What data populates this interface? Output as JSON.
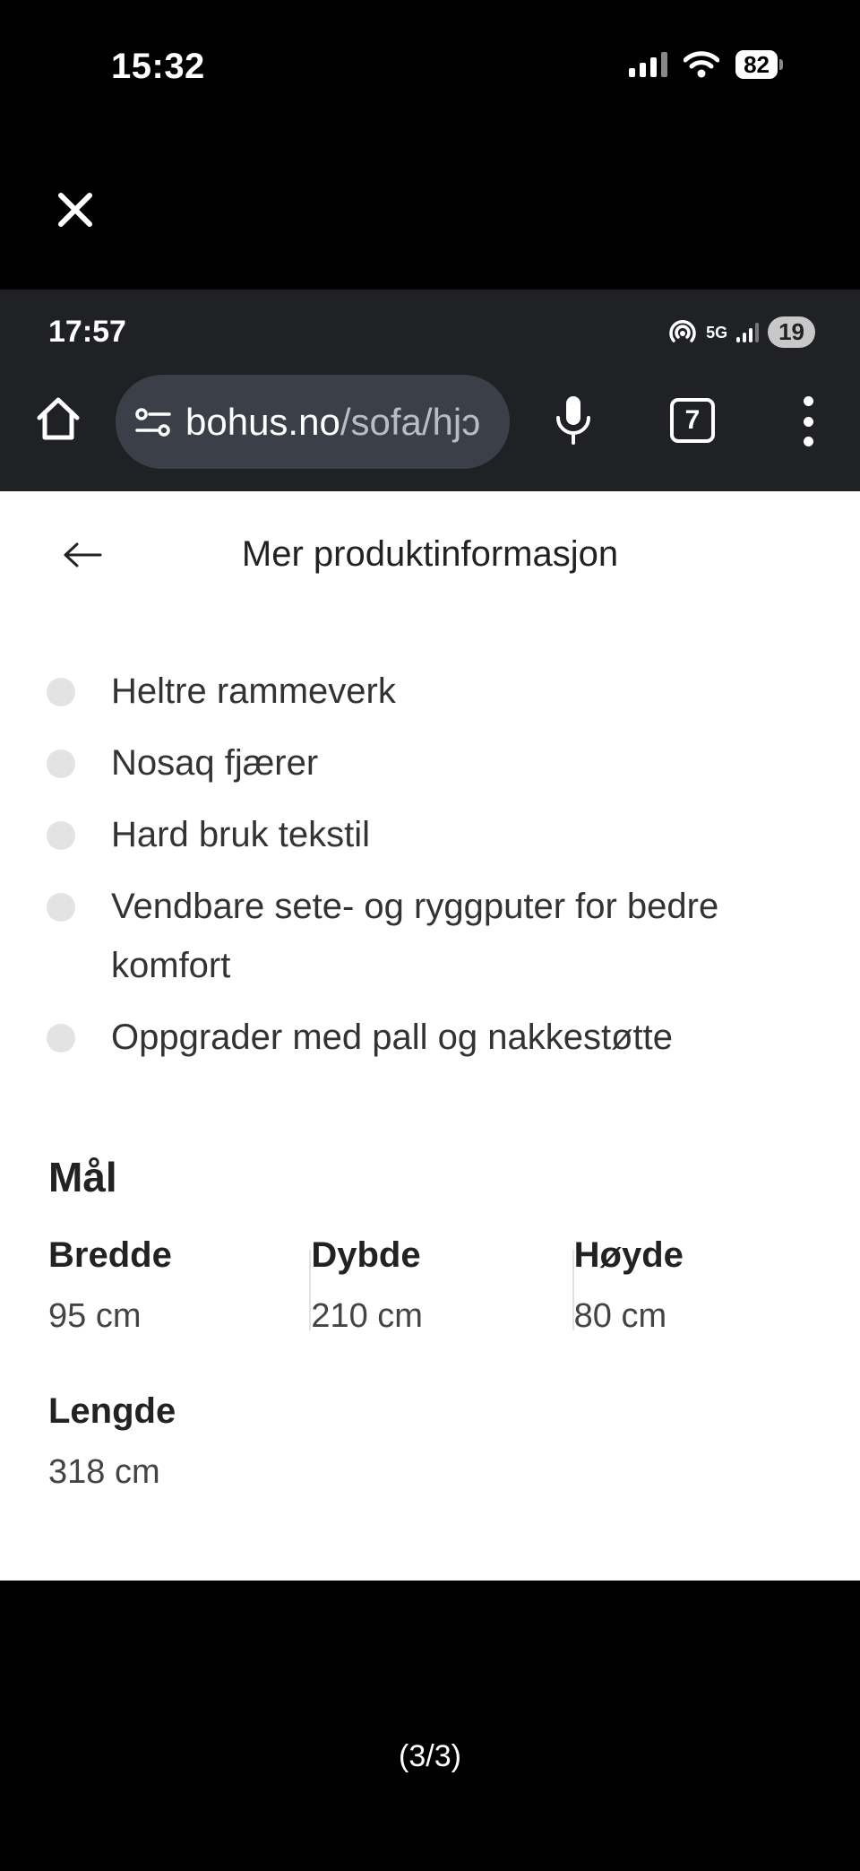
{
  "ios_status": {
    "time": "15:32",
    "battery": "82"
  },
  "android_status": {
    "time": "17:57",
    "network": "5G",
    "badge": "19"
  },
  "browser": {
    "url_host": "bohus.no",
    "url_path": "/sofa/hjɔ",
    "tab_count": "7"
  },
  "page": {
    "title": "Mer produktinformasjon",
    "features": [
      "Heltre rammeverk",
      "Nosaq fjærer",
      "Hard bruk tekstil",
      "Vendbare sete- og ryggputer for bedre komfort",
      "Oppgrader med pall og nakkestøtte"
    ],
    "dimensions_title": "Mål",
    "dimensions": [
      {
        "label": "Bredde",
        "value": "95 cm"
      },
      {
        "label": "Dybde",
        "value": "210 cm"
      },
      {
        "label": "Høyde",
        "value": "80 cm"
      },
      {
        "label": "Lengde",
        "value": "318 cm"
      }
    ]
  },
  "pager": "(3/3)",
  "colors": {
    "chrome": "#1f2125",
    "url_box": "#3b3f47",
    "bullet": "#e3e3e3"
  }
}
